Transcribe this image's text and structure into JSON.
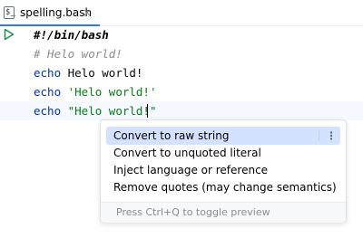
{
  "tab": {
    "title": "spelling.bash",
    "close_glyph": "×",
    "file_icon_glyph": "$_",
    "icon": "bash-file-icon"
  },
  "gutter": {
    "run_icon": "run-icon",
    "run_color": "#1e8f4e"
  },
  "editor": {
    "line1": {
      "text": "#!/bin/bash"
    },
    "line2": {
      "text": "# Helo world!"
    },
    "line3": {
      "kw": "echo",
      "rest": " Helo world!"
    },
    "line4": {
      "kw": "echo",
      "rest": " 'Helo world!'"
    },
    "line5": {
      "kw": "echo",
      "rest": " \"Helo world!\""
    }
  },
  "popup": {
    "items": [
      {
        "label": "Convert to raw string",
        "selected": true,
        "more": "⋮"
      },
      {
        "label": "Convert to unquoted literal"
      },
      {
        "label": "Inject language or reference"
      },
      {
        "label": "Remove quotes (may change semantics)"
      }
    ],
    "footer_hint": "Press Ctrl+Q to toggle preview"
  },
  "colors": {
    "keyword": "#0033b3",
    "string": "#067d17",
    "comment": "#8c8c8c",
    "selection": "#d4e2ff",
    "tab_underline": "#3574f0",
    "current_line": "#f5f8fe"
  }
}
